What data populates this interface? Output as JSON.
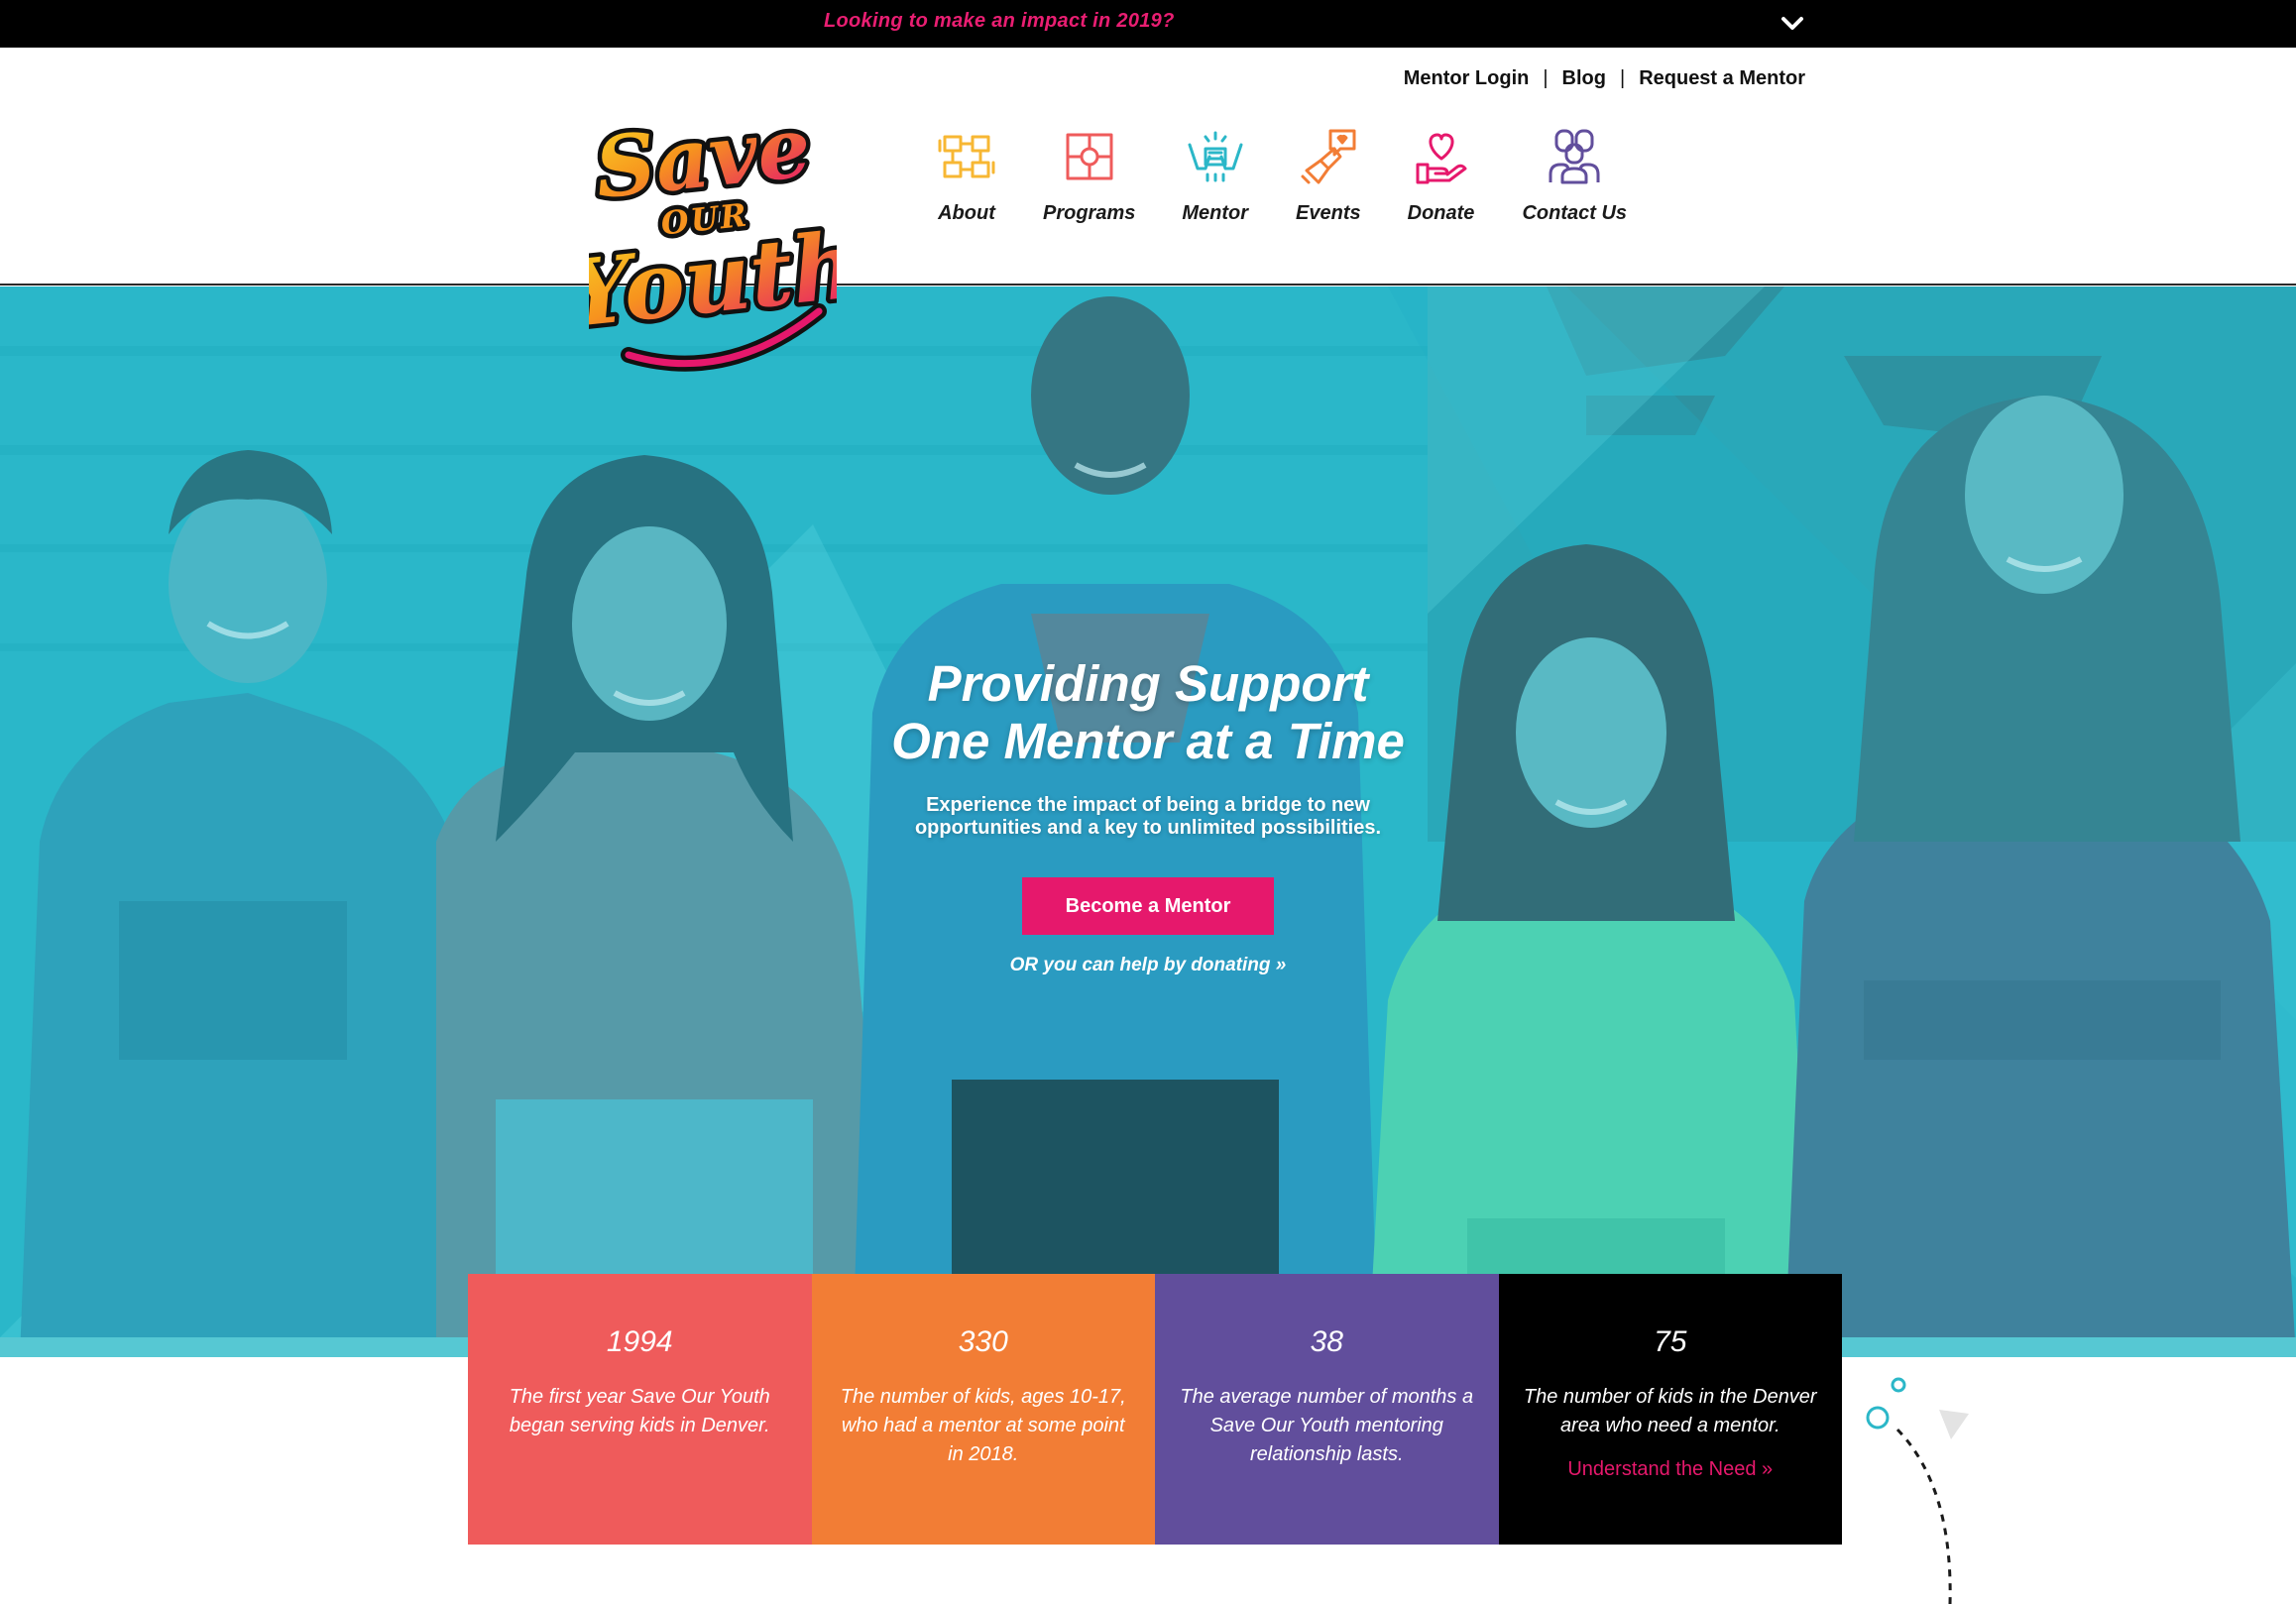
{
  "announcement": {
    "text": "Looking to make an impact in 2019?",
    "toggle_icon": "chevron-down-icon"
  },
  "brand": {
    "logo_line1": "Save",
    "logo_line2": "OUR",
    "logo_line3": "Youth"
  },
  "utility_nav": [
    "Mentor Login",
    "Blog",
    "Request a Mentor"
  ],
  "utility_separator": "|",
  "main_nav": [
    {
      "label": "About",
      "icon": "hands-together-icon"
    },
    {
      "label": "Programs",
      "icon": "puzzle-icon"
    },
    {
      "label": "Mentor",
      "icon": "mentor-pair-icon"
    },
    {
      "label": "Events",
      "icon": "megaphone-icon"
    },
    {
      "label": "Donate",
      "icon": "heart-in-hand-icon"
    },
    {
      "label": "Contact Us",
      "icon": "people-icon"
    }
  ],
  "hero": {
    "title_line1": "Providing Support",
    "title_line2": "One Mentor at a Time",
    "subtitle": "Experience the impact of being a bridge to new opportunities and a key to unlimited possibilities.",
    "cta_label": "Become a Mentor",
    "secondary_link": "OR you can help by donating »"
  },
  "stats": [
    {
      "number": "1994",
      "description": "The first year Save Our Youth began serving kids in Denver.",
      "color": "#ef5b5b"
    },
    {
      "number": "330",
      "description": "The number of kids, ages 10-17, who had a mentor at some point in 2018.",
      "color": "#f27d35"
    },
    {
      "number": "38",
      "description": "The average number of months a Save Our Youth mentoring relationship lasts.",
      "color": "#614e9c"
    },
    {
      "number": "75",
      "description": "The number of kids in the Denver area who need a mentor.",
      "color": "#000000",
      "link": "Understand the Need »"
    }
  ],
  "colors": {
    "accent_pink": "#e6186c",
    "hero_teal": "#2bb7c8",
    "nav_yellow": "#f7b733",
    "nav_coral": "#ef5b5b",
    "nav_teal": "#2bb7c8",
    "nav_orange": "#f27d35",
    "nav_pink": "#e6186c",
    "nav_purple": "#614e9c"
  }
}
